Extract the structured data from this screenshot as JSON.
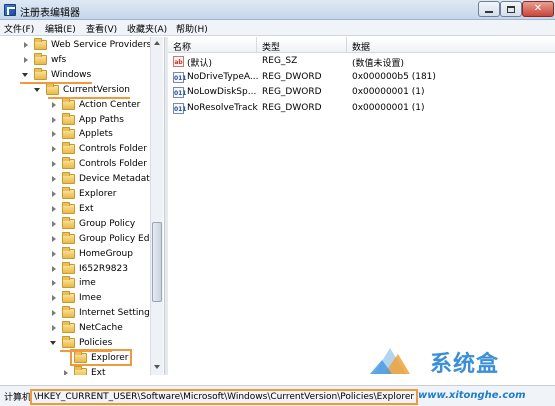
{
  "window": {
    "title": "注册表编辑器"
  },
  "menu": [
    "文件(F)",
    "编辑(E)",
    "查看(V)",
    "收藏夹(A)",
    "帮助(H)"
  ],
  "tree": [
    {
      "label": "Web Service Providers",
      "expander": "collapsed",
      "indent": 0
    },
    {
      "label": "wfs",
      "expander": "collapsed",
      "indent": 0
    },
    {
      "label": "Windows",
      "expander": "expanded",
      "indent": 0
    },
    {
      "label": "CurrentVersion",
      "expander": "expanded",
      "indent": 1
    },
    {
      "label": "Action Center",
      "expander": "collapsed",
      "indent": 2
    },
    {
      "label": "App Paths",
      "expander": "collapsed",
      "indent": 2
    },
    {
      "label": "Applets",
      "expander": "collapsed",
      "indent": 2
    },
    {
      "label": "Controls Folder",
      "expander": "collapsed",
      "indent": 2
    },
    {
      "label": "Controls Folder (",
      "expander": "collapsed",
      "indent": 2
    },
    {
      "label": "Device Metadata",
      "expander": "collapsed",
      "indent": 2
    },
    {
      "label": "Explorer",
      "expander": "collapsed",
      "indent": 2
    },
    {
      "label": "Ext",
      "expander": "collapsed",
      "indent": 2
    },
    {
      "label": "Group Policy",
      "expander": "collapsed",
      "indent": 2
    },
    {
      "label": "Group Policy Edit",
      "expander": "collapsed",
      "indent": 2
    },
    {
      "label": "HomeGroup",
      "expander": "collapsed",
      "indent": 2
    },
    {
      "label": "I652R9823",
      "expander": "collapsed",
      "indent": 2
    },
    {
      "label": "ime",
      "expander": "collapsed",
      "indent": 2
    },
    {
      "label": "Imee",
      "expander": "collapsed",
      "indent": 2
    },
    {
      "label": "Internet Settings",
      "expander": "collapsed",
      "indent": 2
    },
    {
      "label": "NetCache",
      "expander": "collapsed",
      "indent": 2
    },
    {
      "label": "Policies",
      "expander": "expanded",
      "indent": 2
    },
    {
      "label": "Explorer",
      "expander": "none",
      "indent": 3
    },
    {
      "label": "Ext",
      "expander": "collapsed",
      "indent": 3
    }
  ],
  "list": {
    "columns": [
      "名称",
      "类型",
      "数据"
    ],
    "rows": [
      {
        "icon": "ab",
        "name": "(默认)",
        "type": "REG_SZ",
        "data": "(数值未设置)"
      },
      {
        "icon": "011",
        "name": "NoDriveTypeA...",
        "type": "REG_DWORD",
        "data": "0x000000b5 (181)"
      },
      {
        "icon": "011",
        "name": "NoLowDiskSp...",
        "type": "REG_DWORD",
        "data": "0x00000001 (1)"
      },
      {
        "icon": "011",
        "name": "NoResolveTrack",
        "type": "REG_DWORD",
        "data": "0x00000001 (1)"
      }
    ]
  },
  "status": {
    "label": "计算机",
    "path": "\\HKEY_CURRENT_USER\\Software\\Microsoft\\Windows\\CurrentVersion\\Policies\\Explorer"
  },
  "watermark": {
    "brand": "系统盒",
    "url": "www.xitonghe.com"
  }
}
